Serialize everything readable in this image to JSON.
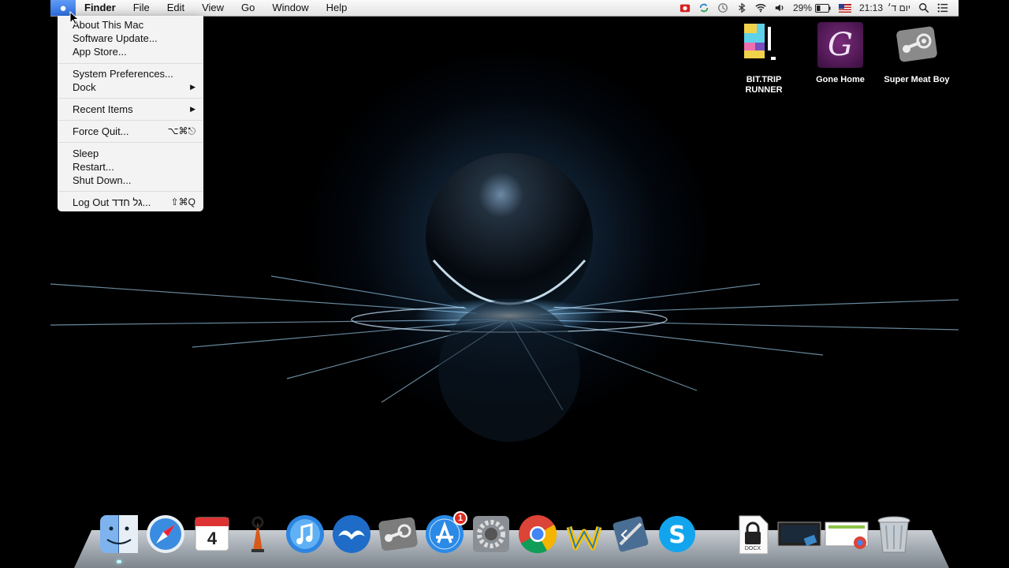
{
  "menubar": {
    "app_name": "Finder",
    "items": [
      "File",
      "Edit",
      "View",
      "Go",
      "Window",
      "Help"
    ],
    "battery": "29%",
    "clock": "21:13",
    "day": "יום ד׳"
  },
  "apple_menu": {
    "items": [
      {
        "label": "About This Mac"
      },
      {
        "label": "Software Update..."
      },
      {
        "label": "App Store..."
      },
      {
        "label": "System Preferences..."
      },
      {
        "label": "Dock",
        "submenu": "▶"
      },
      {
        "label": "Recent Items",
        "submenu": "▶"
      },
      {
        "label": "Force Quit...",
        "shortcut": "⌥⌘⎋"
      },
      {
        "label": "Sleep"
      },
      {
        "label": "Restart..."
      },
      {
        "label": "Shut Down..."
      },
      {
        "label": "Log Out גל חדד...",
        "shortcut": "⇧⌘Q"
      }
    ]
  },
  "desktop_icons": [
    {
      "label": "BIT.TRIP RUNNER",
      "icon": "bit-trip-runner-icon"
    },
    {
      "label": "Gone Home",
      "icon": "gone-home-icon"
    },
    {
      "label": "Super Meat Boy",
      "icon": "steam-icon"
    }
  ],
  "dock": {
    "items": [
      "Finder",
      "Safari",
      "Calendar",
      "Folx",
      "iTunes",
      "OpenOffice",
      "Steam",
      "App Store",
      "System Preferences",
      "Chrome",
      "Wunderlist",
      "Xcode",
      "Skype",
      "Documents",
      "Downloads",
      "Chrome Apps",
      "Trash"
    ],
    "calendar_day": "4",
    "appstore_badge": "1",
    "docx_label": "DOCX"
  },
  "colors": {
    "menu_highlight": "#3d7ae5",
    "wallpaper_glow": "#1f3b55"
  }
}
